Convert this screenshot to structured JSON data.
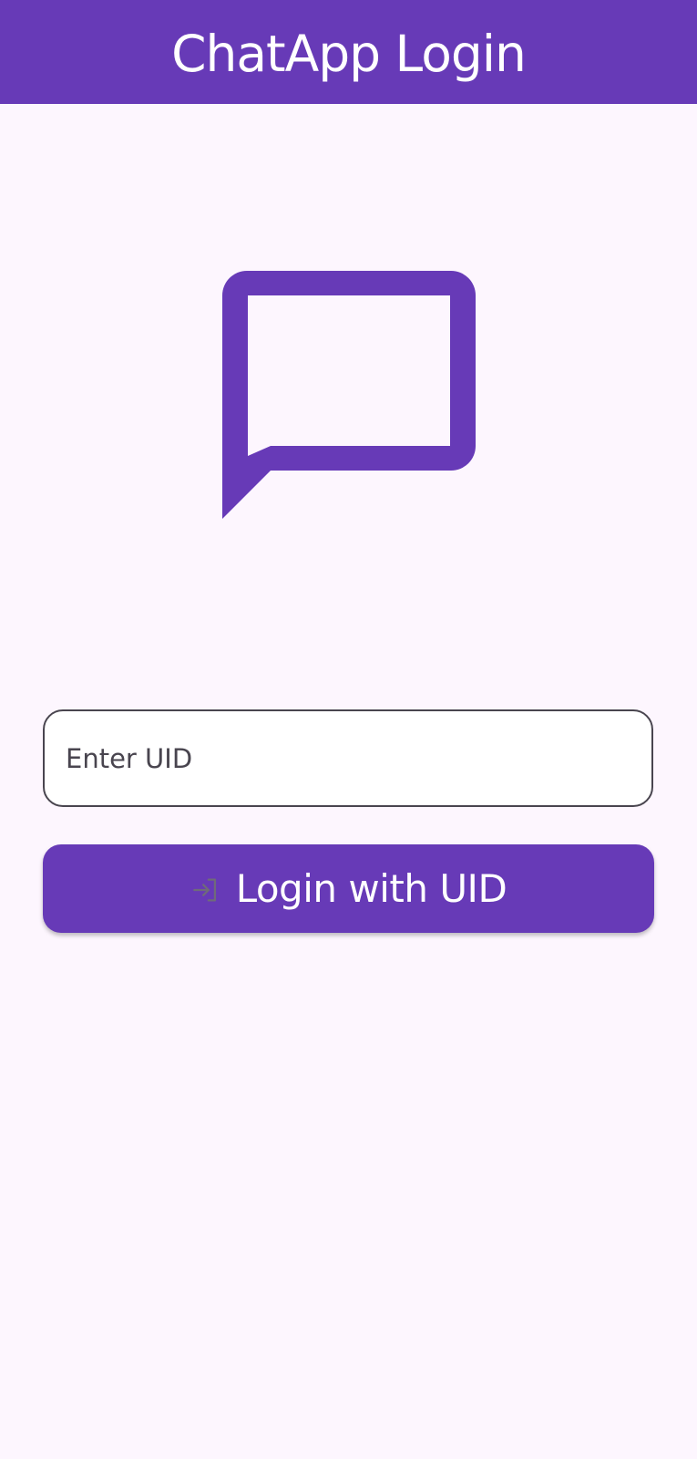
{
  "app_bar": {
    "title": "ChatApp Login"
  },
  "logo": {
    "icon": "chat-bubble-outline-icon",
    "color": "#673ab7"
  },
  "uid_field": {
    "placeholder": "Enter UID",
    "value": ""
  },
  "login_button": {
    "icon": "login-icon",
    "label": "Login with UID"
  },
  "colors": {
    "primary": "#673ab7",
    "background": "#fdf6fe",
    "on_primary": "#ffffff",
    "field_border": "#49454f",
    "icon_muted": "#6f6a7a"
  }
}
